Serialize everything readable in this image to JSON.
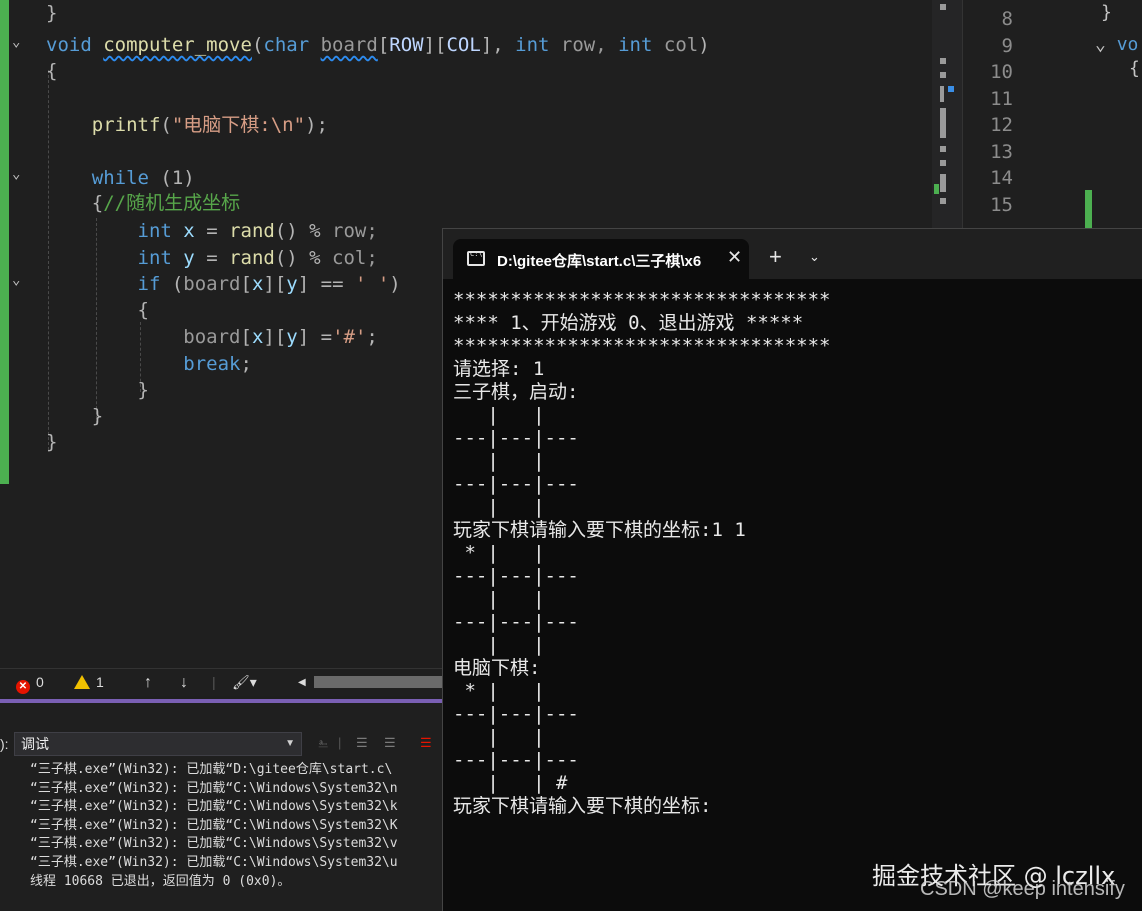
{
  "editor": {
    "lines": [
      {
        "parts": [
          {
            "t": "}",
            "c": "op"
          }
        ]
      },
      {
        "parts": [
          {
            "t": "void",
            "c": "kw"
          },
          {
            "t": " ",
            "c": ""
          },
          {
            "t": "computer_move",
            "c": "fn wavy"
          },
          {
            "t": "(",
            "c": "op"
          },
          {
            "t": "char",
            "c": "kw"
          },
          {
            "t": " ",
            "c": ""
          },
          {
            "t": "board",
            "c": "pm wavy"
          },
          {
            "t": "[",
            "c": "op"
          },
          {
            "t": "ROW",
            "c": "mac"
          },
          {
            "t": "][",
            "c": "op"
          },
          {
            "t": "COL",
            "c": "mac"
          },
          {
            "t": "], ",
            "c": "op"
          },
          {
            "t": "int",
            "c": "kw"
          },
          {
            "t": " row, ",
            "c": "pm"
          },
          {
            "t": "int",
            "c": "kw"
          },
          {
            "t": " col",
            "c": "pm"
          },
          {
            "t": ")",
            "c": "op"
          }
        ]
      },
      {
        "parts": [
          {
            "t": "{",
            "c": "op"
          }
        ]
      },
      {
        "parts": []
      },
      {
        "parts": [
          {
            "t": "    ",
            "c": ""
          },
          {
            "t": "printf",
            "c": "fn"
          },
          {
            "t": "(",
            "c": "op"
          },
          {
            "t": "\"电脑下棋:\\n\"",
            "c": "str"
          },
          {
            "t": ");",
            "c": "op"
          }
        ]
      },
      {
        "parts": []
      },
      {
        "parts": [
          {
            "t": "    ",
            "c": ""
          },
          {
            "t": "while",
            "c": "kw"
          },
          {
            "t": " (1)",
            "c": "op"
          }
        ]
      },
      {
        "parts": [
          {
            "t": "    ",
            "c": ""
          },
          {
            "t": "{",
            "c": "op"
          },
          {
            "t": "//随机生成坐标",
            "c": "cm"
          }
        ]
      },
      {
        "parts": [
          {
            "t": "        ",
            "c": ""
          },
          {
            "t": "int",
            "c": "kw"
          },
          {
            "t": " ",
            "c": ""
          },
          {
            "t": "x",
            "c": "vr"
          },
          {
            "t": " = ",
            "c": "op"
          },
          {
            "t": "rand",
            "c": "fn"
          },
          {
            "t": "() % ",
            "c": "op"
          },
          {
            "t": "row;",
            "c": "pm"
          }
        ]
      },
      {
        "parts": [
          {
            "t": "        ",
            "c": ""
          },
          {
            "t": "int",
            "c": "kw"
          },
          {
            "t": " ",
            "c": ""
          },
          {
            "t": "y",
            "c": "vr"
          },
          {
            "t": " = ",
            "c": "op"
          },
          {
            "t": "rand",
            "c": "fn"
          },
          {
            "t": "() % ",
            "c": "op"
          },
          {
            "t": "col;",
            "c": "pm"
          }
        ]
      },
      {
        "parts": [
          {
            "t": "        ",
            "c": ""
          },
          {
            "t": "if",
            "c": "kw"
          },
          {
            "t": " (",
            "c": "op"
          },
          {
            "t": "board",
            "c": "pm"
          },
          {
            "t": "[",
            "c": "op"
          },
          {
            "t": "x",
            "c": "vr"
          },
          {
            "t": "][",
            "c": "op"
          },
          {
            "t": "y",
            "c": "vr"
          },
          {
            "t": "] == ",
            "c": "op"
          },
          {
            "t": "' '",
            "c": "str"
          },
          {
            "t": ")",
            "c": "op"
          }
        ]
      },
      {
        "parts": [
          {
            "t": "        ",
            "c": ""
          },
          {
            "t": "{",
            "c": "op"
          }
        ]
      },
      {
        "parts": [
          {
            "t": "            ",
            "c": ""
          },
          {
            "t": "board",
            "c": "pm"
          },
          {
            "t": "[",
            "c": "op"
          },
          {
            "t": "x",
            "c": "vr"
          },
          {
            "t": "][",
            "c": "op"
          },
          {
            "t": "y",
            "c": "vr"
          },
          {
            "t": "] =",
            "c": "op"
          },
          {
            "t": "'#'",
            "c": "str"
          },
          {
            "t": ";",
            "c": "op"
          }
        ]
      },
      {
        "parts": [
          {
            "t": "            ",
            "c": ""
          },
          {
            "t": "break",
            "c": "kw"
          },
          {
            "t": ";",
            "c": "op"
          }
        ]
      },
      {
        "parts": [
          {
            "t": "        ",
            "c": ""
          },
          {
            "t": "}",
            "c": "op"
          }
        ]
      },
      {
        "parts": [
          {
            "t": "    ",
            "c": ""
          },
          {
            "t": "}",
            "c": "op"
          }
        ]
      },
      {
        "parts": [
          {
            "t": "}",
            "c": "op"
          }
        ]
      }
    ]
  },
  "pane2": {
    "line_numbers": [
      "8",
      "9",
      "10",
      "11",
      "12",
      "13",
      "14",
      "15"
    ]
  },
  "error_bar": {
    "error_count": "0",
    "warning_count": "1"
  },
  "output": {
    "source_label": "):",
    "source_value": "调试",
    "lines": [
      "“三子棋.exe”(Win32): 已加载“D:\\gitee仓库\\start.c\\",
      "“三子棋.exe”(Win32): 已加载“C:\\Windows\\System32\\n",
      "“三子棋.exe”(Win32): 已加载“C:\\Windows\\System32\\k",
      "“三子棋.exe”(Win32): 已加载“C:\\Windows\\System32\\K",
      "“三子棋.exe”(Win32): 已加载“C:\\Windows\\System32\\v",
      "“三子棋.exe”(Win32): 已加载“C:\\Windows\\System32\\u",
      "线程 10668 已退出，返回值为 0 (0x0)。"
    ]
  },
  "terminal": {
    "tab_title": "D:\\gitee仓库\\start.c\\三子棋\\x6",
    "close_glyph": "✕",
    "newtab_glyph": "+",
    "dropdown_glyph": "⌄",
    "lines": [
      "*********************************",
      "**** 1、开始游戏 0、退出游戏 *****",
      "*********************************",
      "请选择: 1",
      "三子棋，启动:",
      "   |   |   ",
      "---|---|---",
      "   |   |   ",
      "---|---|---",
      "   |   |   ",
      "玩家下棋请输入要下棋的坐标:1 1",
      " * |   |   ",
      "---|---|---",
      "   |   |   ",
      "---|---|---",
      "   |   |   ",
      "电脑下棋:",
      " * |   |   ",
      "---|---|---",
      "   |   |   ",
      "---|---|---",
      "   |   | # ",
      "玩家下棋请输入要下棋的坐标:"
    ]
  },
  "watermark": {
    "line1": "掘金技术社区 @ lczllx",
    "line2": "CSDN @keep intensify"
  }
}
